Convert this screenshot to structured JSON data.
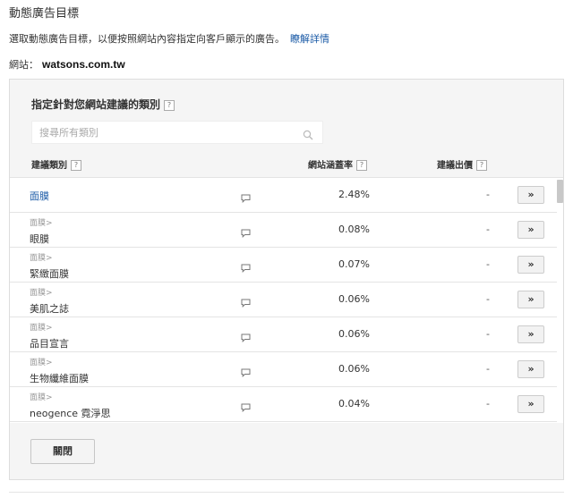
{
  "header": {
    "title": "動態廣告目標",
    "description": "選取動態廣告目標，以便按照網站內容指定向客戶顯示的廣告。",
    "details_link": "瞭解詳情",
    "site_label": "網站：",
    "site_domain": "watsons.com.tw"
  },
  "panel": {
    "title": "指定針對您網站建議的類別",
    "help_glyph": "?",
    "search": {
      "placeholder": "搜尋所有類別",
      "value": ""
    },
    "columns": {
      "category": "建議類別",
      "coverage": "網站涵蓋率",
      "bid": "建議出價"
    },
    "rows": [
      {
        "parent": "",
        "name": "面膜",
        "coverage": "2.48%",
        "bid": "-",
        "action": "»"
      },
      {
        "parent": "面膜>",
        "name": "眼膜",
        "coverage": "0.08%",
        "bid": "-",
        "action": "»"
      },
      {
        "parent": "面膜>",
        "name": "緊緻面膜",
        "coverage": "0.07%",
        "bid": "-",
        "action": "»"
      },
      {
        "parent": "面膜>",
        "name": "美肌之誌",
        "coverage": "0.06%",
        "bid": "-",
        "action": "»"
      },
      {
        "parent": "面膜>",
        "name": "品目宣言",
        "coverage": "0.06%",
        "bid": "-",
        "action": "»"
      },
      {
        "parent": "面膜>",
        "name": "生物纖維面膜",
        "coverage": "0.06%",
        "bid": "-",
        "action": "»"
      },
      {
        "parent": "面膜>",
        "name": "neogence 霓淨思",
        "coverage": "0.04%",
        "bid": "-",
        "action": "»"
      }
    ],
    "close_label": "關閉"
  },
  "icons": {
    "search": "magnifier-icon",
    "comment": "speech-bubble-icon",
    "help": "question-mark-icon"
  },
  "colors": {
    "link": "#1a5aa6",
    "panel_bg": "#f5f5f5",
    "border": "#dddddd"
  }
}
